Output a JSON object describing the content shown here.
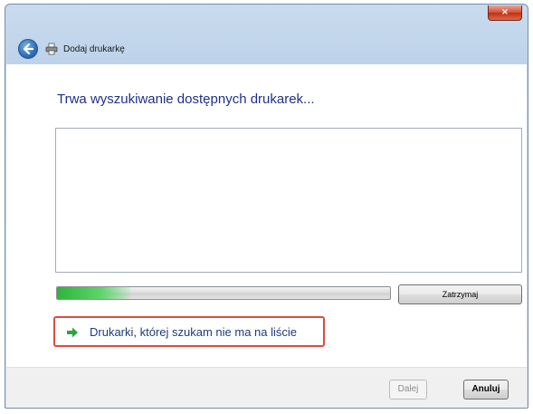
{
  "window": {
    "title": "Dodaj drukarkę",
    "close_label": "×"
  },
  "icons": {
    "back": "back-arrow-icon",
    "printer": "printer-icon",
    "link_arrow": "green-arrow-icon"
  },
  "main": {
    "heading": "Trwa wyszukiwanie dostępnych drukarek...",
    "printer_list": [],
    "progress_fraction": 0.22,
    "stop_label": "Zatrzymaj",
    "link_text": "Drukarki, której szukam nie ma na liście"
  },
  "footer": {
    "next_label": "Dalej",
    "cancel_label": "Anuluj"
  },
  "colors": {
    "heading": "#1e3287",
    "link_highlight": "#e04a3c",
    "progress": "#2db43a"
  }
}
